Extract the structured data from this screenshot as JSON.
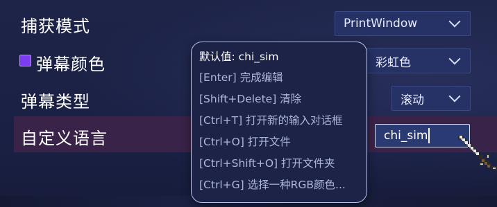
{
  "settings": {
    "capture_mode": {
      "label": "捕获模式",
      "value": "PrintWindow"
    },
    "danmaku_color": {
      "label": "弹幕颜色",
      "value": "彩虹色",
      "swatch_color": "#7c3cf0"
    },
    "danmaku_type": {
      "label": "弹幕类型",
      "value": "滚动"
    },
    "custom_language": {
      "label": "自定义语言",
      "value": "chi_sim"
    }
  },
  "tooltip": {
    "lines": [
      "默认值: chi_sim",
      "[Enter] 完成编辑",
      "[Shift+Delete] 清除",
      "[Ctrl+T] 打开新的输入对话框",
      "[Ctrl+O] 打开文件",
      "[Ctrl+Shift+O] 打开文件夹",
      "[Ctrl+G] 选择一种RGB颜色..."
    ]
  },
  "colors": {
    "background": "#1b2145",
    "highlight_row": "#3a2348",
    "dropdown_bg": "#263266",
    "input_border": "#d7e2ff",
    "tooltip_border": "#b8c2ee"
  },
  "icons": {
    "cursor": "pixel-sword-cursor-icon",
    "dropdown": "chevron-down-icon"
  }
}
